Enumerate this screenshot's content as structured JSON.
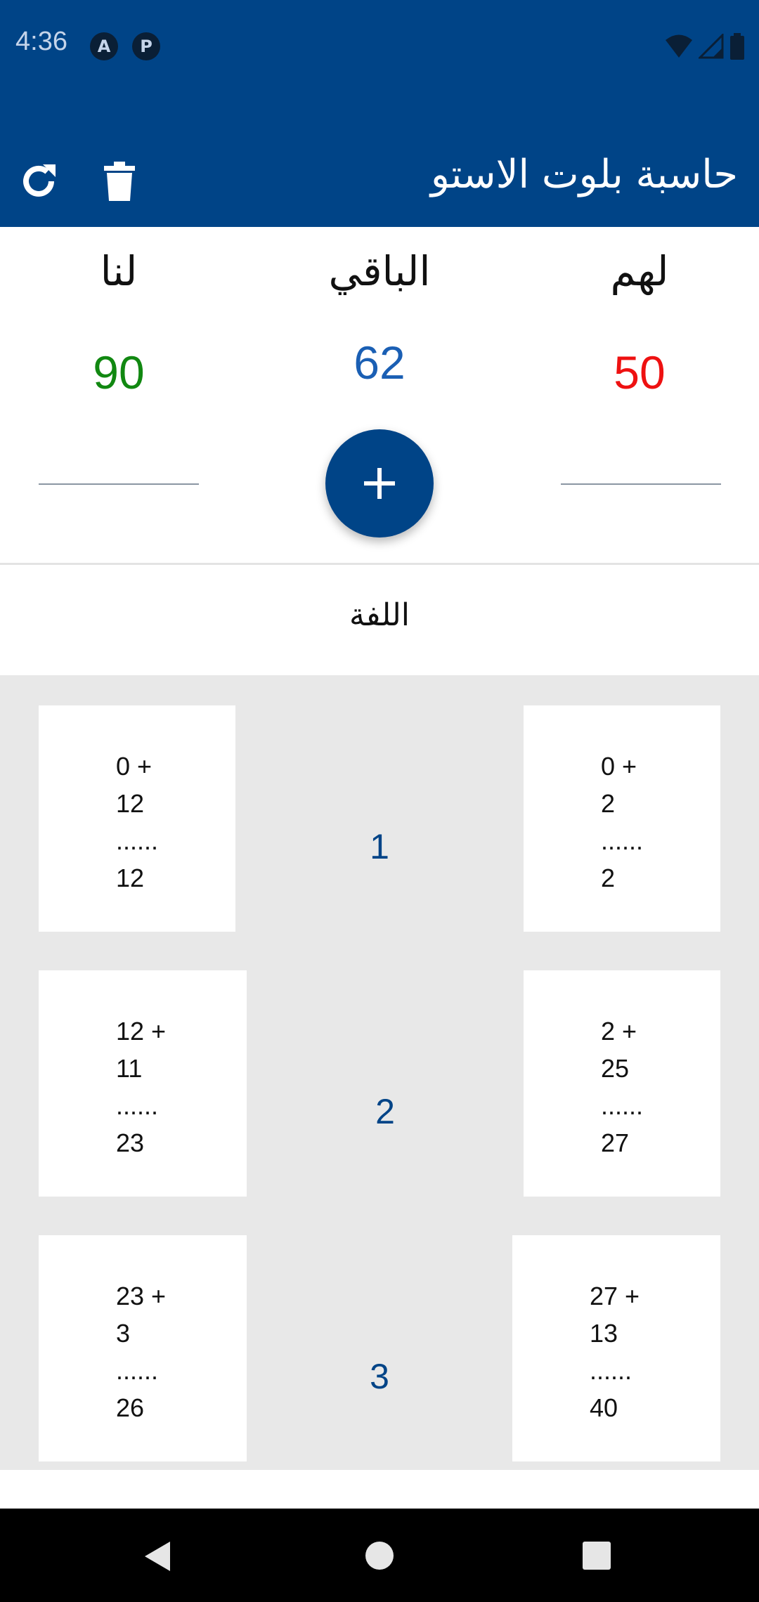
{
  "status_bar": {
    "time": "4:36",
    "icons": [
      "notification-a-icon",
      "notification-p-icon",
      "wifi-icon",
      "signal-icon",
      "battery-icon"
    ]
  },
  "app_bar": {
    "title": "حاسبة بلوت الاستو",
    "actions": [
      "refresh-icon",
      "delete-icon"
    ]
  },
  "scoreboard": {
    "them": {
      "label": "لهم",
      "score": "50",
      "color": "#ee1111"
    },
    "remaining": {
      "label": "الباقي",
      "score": "62",
      "color": "#1a5fb4"
    },
    "us": {
      "label": "لنا",
      "score": "90",
      "color": "#118811"
    },
    "add_button_icon": "plus-icon"
  },
  "section": {
    "label": "اللفة"
  },
  "rounds": [
    {
      "number": "1",
      "us": {
        "prev": "0 +",
        "add": "12",
        "sep": "......",
        "total": "12"
      },
      "them": {
        "prev": "0 +",
        "add": "2",
        "sep": "......",
        "total": "2"
      }
    },
    {
      "number": "2",
      "us": {
        "prev": "12 +",
        "add": "11",
        "sep": "......",
        "total": "23"
      },
      "them": {
        "prev": "2 +",
        "add": "25",
        "sep": "......",
        "total": "27"
      }
    },
    {
      "number": "3",
      "us": {
        "prev": "23 +",
        "add": "3",
        "sep": "......",
        "total": "26"
      },
      "them": {
        "prev": "27 +",
        "add": "13",
        "sep": "......",
        "total": "40"
      }
    }
  ],
  "colors": {
    "primary": "#004487",
    "list_bg": "#e8e8e8"
  },
  "nav_bar": {
    "buttons": [
      "back-icon",
      "home-icon",
      "recents-icon"
    ]
  }
}
